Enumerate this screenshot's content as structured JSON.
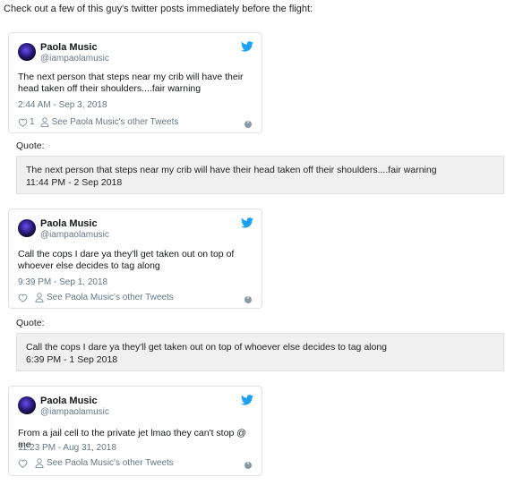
{
  "intro": "Check out a few of this guy's twitter posts immediately before the flight:",
  "tweets": [
    {
      "name": "Paola Music",
      "handle": "@iampaolamusic",
      "text": "The next person that steps near my crib will have their head taken off their shoulders....fair warning",
      "date": "2:44 AM - Sep 3, 2018",
      "likes": "1",
      "see_other": "See Paola Music's other Tweets"
    },
    {
      "name": "Paola Music",
      "handle": "@iampaolamusic",
      "text": "Call the cops I dare ya they'll get taken out on top of whoever else decides to tag along",
      "date": "9:39 PM - Sep 1, 2018",
      "likes": "",
      "see_other": "See Paola Music's other Tweets"
    },
    {
      "name": "Paola Music",
      "handle": "@iampaolamusic",
      "text": "From a jail cell to the private jet lmao they can't stop @ me",
      "date": "11:23 PM - Aug 31, 2018",
      "likes": "",
      "see_other": "See Paola Music's other Tweets"
    }
  ],
  "quotes": [
    {
      "label": "Quote:",
      "text": "The next person that steps near my crib will have their head taken off their shoulders....fair warning",
      "date": "11:44 PM - 2 Sep 2018"
    },
    {
      "label": "Quote:",
      "text": "Call the cops I dare ya they'll get taken out on top of whoever else decides to tag along",
      "date": "6:39 PM - 1 Sep 2018"
    }
  ],
  "colors": {
    "twitter_blue": "#1da1f2",
    "muted": "#657786",
    "quote_bg": "#f0f0f0"
  },
  "icons": [
    "twitter-bird-icon",
    "heart-icon",
    "person-icon",
    "info-icon"
  ]
}
